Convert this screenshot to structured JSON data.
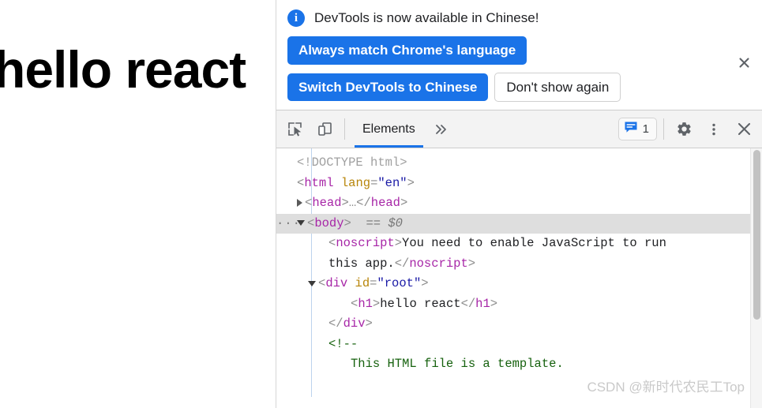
{
  "page": {
    "heading": "hello react"
  },
  "notification": {
    "icon": "info-icon",
    "message": "DevTools is now available in Chinese!",
    "primary_button_1": "Always match Chrome's language",
    "primary_button_2": "Switch DevTools to Chinese",
    "secondary_button": "Don't show again",
    "close_icon": "close-icon",
    "accent_color": "#1a73e8"
  },
  "toolbar": {
    "inspect_icon": "inspect-element-icon",
    "device_icon": "device-toolbar-icon",
    "tabs": [
      {
        "label": "Elements",
        "active": true
      }
    ],
    "more_tabs_icon": "chevron-double-right-icon",
    "issues": {
      "icon": "issues-message-icon",
      "count": "1"
    },
    "settings_icon": "gear-icon",
    "menu_icon": "kebab-menu-icon",
    "close_icon": "close-icon"
  },
  "dom_tree": {
    "lines": [
      {
        "id": "doctype",
        "indent": 1,
        "twisty": "none",
        "selected": false,
        "tokens": [
          {
            "cls": "tkn-doctype",
            "t": "<!DOCTYPE html>"
          }
        ]
      },
      {
        "id": "html-open",
        "indent": 1,
        "twisty": "none",
        "selected": false,
        "tokens": [
          {
            "cls": "tkn-punct",
            "t": "<"
          },
          {
            "cls": "tkn-tag",
            "t": "html"
          },
          {
            "cls": "tkn-text",
            "t": " "
          },
          {
            "cls": "tkn-attr",
            "t": "lang"
          },
          {
            "cls": "tkn-punct",
            "t": "="
          },
          {
            "cls": "tkn-val",
            "t": "\"en\""
          },
          {
            "cls": "tkn-punct",
            "t": ">"
          }
        ]
      },
      {
        "id": "head",
        "indent": 1,
        "twisty": "closed",
        "selected": false,
        "tokens": [
          {
            "cls": "tkn-punct",
            "t": "<"
          },
          {
            "cls": "tkn-tag",
            "t": "head"
          },
          {
            "cls": "tkn-punct",
            "t": ">"
          },
          {
            "cls": "tkn-punct",
            "t": "…"
          },
          {
            "cls": "tkn-punct",
            "t": "</"
          },
          {
            "cls": "tkn-tag",
            "t": "head"
          },
          {
            "cls": "tkn-punct",
            "t": ">"
          }
        ]
      },
      {
        "id": "body",
        "indent": 1,
        "twisty": "open",
        "selected": true,
        "marker": "···",
        "tokens": [
          {
            "cls": "tkn-punct",
            "t": "<"
          },
          {
            "cls": "tkn-tag",
            "t": "body"
          },
          {
            "cls": "tkn-punct",
            "t": ">"
          },
          {
            "cls": "tkn-dollar",
            "t": "  == $0"
          }
        ]
      },
      {
        "id": "noscript-1",
        "indent": 3,
        "twisty": "none",
        "selected": false,
        "tokens": [
          {
            "cls": "tkn-punct",
            "t": "<"
          },
          {
            "cls": "tkn-tag",
            "t": "noscript"
          },
          {
            "cls": "tkn-punct",
            "t": ">"
          },
          {
            "cls": "tkn-text",
            "t": "You need to enable JavaScript to run"
          }
        ]
      },
      {
        "id": "noscript-2",
        "indent": 3,
        "twisty": "none",
        "selected": false,
        "tokens": [
          {
            "cls": "tkn-text",
            "t": "this app."
          },
          {
            "cls": "tkn-punct",
            "t": "</"
          },
          {
            "cls": "tkn-tag",
            "t": "noscript"
          },
          {
            "cls": "tkn-punct",
            "t": ">"
          }
        ]
      },
      {
        "id": "div-root-open",
        "indent": 2,
        "twisty": "open",
        "selected": false,
        "tokens": [
          {
            "cls": "tkn-punct",
            "t": "<"
          },
          {
            "cls": "tkn-tag",
            "t": "div"
          },
          {
            "cls": "tkn-text",
            "t": " "
          },
          {
            "cls": "tkn-attr",
            "t": "id"
          },
          {
            "cls": "tkn-punct",
            "t": "="
          },
          {
            "cls": "tkn-val",
            "t": "\"root\""
          },
          {
            "cls": "tkn-punct",
            "t": ">"
          }
        ]
      },
      {
        "id": "h1",
        "indent": 4,
        "twisty": "none",
        "selected": false,
        "tokens": [
          {
            "cls": "tkn-punct",
            "t": "<"
          },
          {
            "cls": "tkn-tag",
            "t": "h1"
          },
          {
            "cls": "tkn-punct",
            "t": ">"
          },
          {
            "cls": "tkn-text",
            "t": "hello react"
          },
          {
            "cls": "tkn-punct",
            "t": "</"
          },
          {
            "cls": "tkn-tag",
            "t": "h1"
          },
          {
            "cls": "tkn-punct",
            "t": ">"
          }
        ]
      },
      {
        "id": "div-root-close",
        "indent": 3,
        "twisty": "none",
        "selected": false,
        "tokens": [
          {
            "cls": "tkn-punct",
            "t": "</"
          },
          {
            "cls": "tkn-tag",
            "t": "div"
          },
          {
            "cls": "tkn-punct",
            "t": ">"
          }
        ]
      },
      {
        "id": "comment-open",
        "indent": 3,
        "twisty": "none",
        "selected": false,
        "tokens": [
          {
            "cls": "tkn-comment",
            "t": "<!--"
          }
        ]
      },
      {
        "id": "comment-body",
        "indent": 4,
        "twisty": "none",
        "selected": false,
        "tokens": [
          {
            "cls": "tkn-comment",
            "t": "This HTML file is a template."
          }
        ]
      }
    ]
  },
  "watermark": {
    "text": "CSDN @新时代农民工Top"
  }
}
